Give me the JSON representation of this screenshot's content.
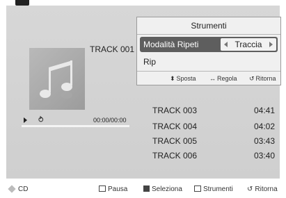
{
  "player": {
    "current_track": "TRACK 001",
    "time": "00:00/00:00",
    "progress": 0.0
  },
  "tools_popup": {
    "title": "Strumenti",
    "option_label": "Modalità Ripeti",
    "option_value": "Traccia",
    "rip_label": "Rip",
    "hints": {
      "move": "Sposta",
      "adjust": "Regola",
      "back": "Ritorna"
    }
  },
  "tracks": [
    {
      "name": "TRACK 003",
      "time": "04:41"
    },
    {
      "name": "TRACK 004",
      "time": "04:02"
    },
    {
      "name": "TRACK 005",
      "time": "03:43"
    },
    {
      "name": "TRACK 006",
      "time": "03:40"
    }
  ],
  "bottom_bar": {
    "source": "CD",
    "pause": "Pausa",
    "select": "Seleziona",
    "tools": "Strumenti",
    "back": "Ritorna"
  },
  "icons": {
    "repeat": "repeat-icon",
    "play": "play-icon",
    "music-note": "music-note-icon"
  }
}
